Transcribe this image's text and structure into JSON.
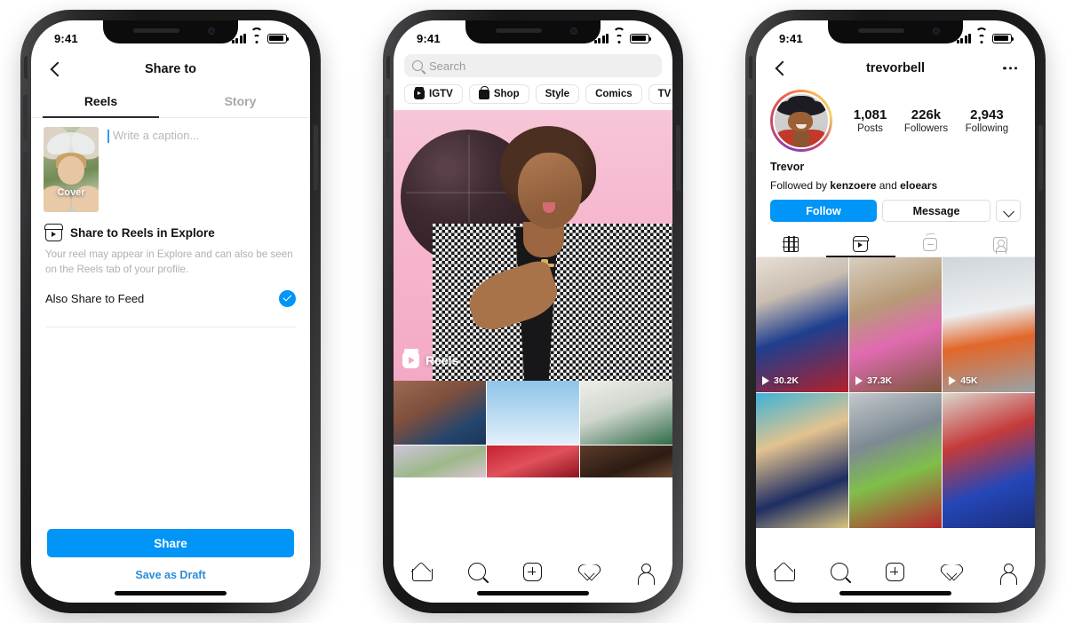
{
  "status_bar": {
    "time": "9:41",
    "icons": [
      "cellular-signal",
      "wifi",
      "battery"
    ]
  },
  "phone1": {
    "nav": {
      "back_icon": "chevron-left",
      "title": "Share to"
    },
    "tabs": [
      {
        "label": "Reels",
        "active": true
      },
      {
        "label": "Story",
        "active": false
      }
    ],
    "cover": {
      "label": "Cover"
    },
    "caption": {
      "placeholder": "Write a caption..."
    },
    "explore_section": {
      "icon": "reels-icon",
      "title": "Share to Reels in Explore",
      "description": "Your reel may appear in Explore and can also be seen on the Reels tab of your profile."
    },
    "also_share": {
      "label": "Also Share to Feed",
      "checked": true,
      "check_color": "#0095f6"
    },
    "footer": {
      "primary": "Share",
      "secondary": "Save as Draft",
      "primary_color": "#0095f6",
      "secondary_color": "#2b8cd8"
    }
  },
  "phone2": {
    "search": {
      "placeholder": "Search",
      "icon": "search-icon"
    },
    "chips": [
      {
        "label": "IGTV",
        "icon": "igtv-icon"
      },
      {
        "label": "Shop",
        "icon": "shop-icon"
      },
      {
        "label": "Style",
        "icon": null
      },
      {
        "label": "Comics",
        "icon": null
      },
      {
        "label": "TV & Movie",
        "icon": null
      }
    ],
    "hero": {
      "badge_label": "Reels",
      "badge_icon": "reels-icon"
    },
    "tabbar": [
      "home-icon",
      "search-icon",
      "create-icon",
      "activity-icon",
      "profile-icon"
    ]
  },
  "phone3": {
    "nav": {
      "back_icon": "chevron-left",
      "username": "trevorbell",
      "more_icon": "more-options-icon"
    },
    "stats": [
      {
        "num": "1,081",
        "cap": "Posts"
      },
      {
        "num": "226k",
        "cap": "Followers"
      },
      {
        "num": "2,943",
        "cap": "Following"
      }
    ],
    "display_name": "Trevor",
    "followed_by": {
      "prefix": "Followed by ",
      "user1": "kenzoere",
      "join": " and ",
      "user2": "eloears"
    },
    "actions": {
      "follow": "Follow",
      "message": "Message",
      "caret_icon": "chevron-down-icon",
      "follow_color": "#0095f6"
    },
    "tabs": [
      {
        "icon": "grid-icon",
        "active": false
      },
      {
        "icon": "reels-icon",
        "active": true
      },
      {
        "icon": "igtv-icon",
        "active": false
      },
      {
        "icon": "tagged-icon",
        "active": false
      }
    ],
    "reels": [
      {
        "views": "30.2K"
      },
      {
        "views": "37.3K"
      },
      {
        "views": "45K"
      },
      {
        "views": ""
      },
      {
        "views": ""
      },
      {
        "views": ""
      }
    ],
    "tabbar": [
      "home-icon",
      "search-icon",
      "create-icon",
      "activity-icon",
      "profile-icon"
    ]
  }
}
